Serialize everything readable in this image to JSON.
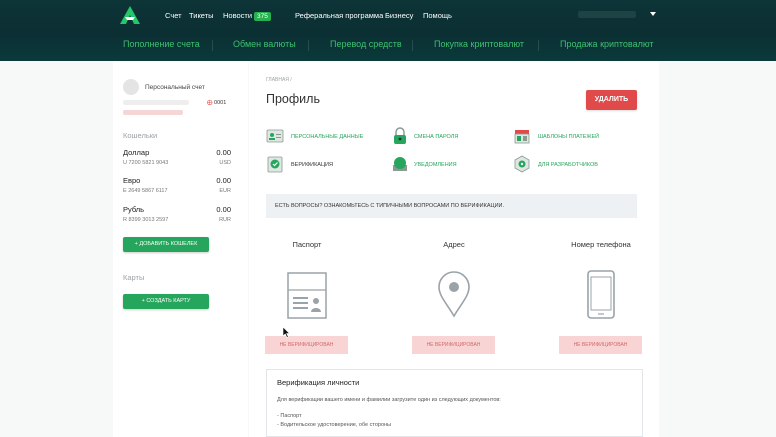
{
  "header": {
    "nav": {
      "account": "Счет",
      "tickets": "Тикеты",
      "news": "Новости",
      "news_count": "375",
      "referral": "Реферальная программа",
      "business": "Бизнесу",
      "help": "Помощь"
    },
    "subnav": [
      "Пополнение счета",
      "Обмен валюты",
      "Перевод средств",
      "Покупка криптовалют",
      "Продажа криптовалют"
    ],
    "colors": {
      "accent": "#26a55c",
      "header_bg": "#0b2f33",
      "danger": "#e04a4a"
    }
  },
  "sidebar": {
    "account_label": "Персональный счет",
    "account_id_prefix": "⨁",
    "account_id": "0001",
    "wallets_title": "Кошельки",
    "wallets": [
      {
        "name": "Доллар",
        "amount": "0.00",
        "number": "U 7200 5821 9043",
        "currency": "USD"
      },
      {
        "name": "Евро",
        "amount": "0.00",
        "number": "E 2649 5867 6117",
        "currency": "EUR"
      },
      {
        "name": "Рубль",
        "amount": "0.00",
        "number": "R 8399 3013 2597",
        "currency": "RUR"
      }
    ],
    "add_wallet": "+ ДОБАВИТЬ КОШЕЛЕК",
    "cards_title": "Карты",
    "create_card": "+ СОЗДАТЬ КАРТУ"
  },
  "main": {
    "breadcrumb": "ГЛАВНАЯ /",
    "title": "Профиль",
    "delete_button": "УДАЛИТЬ",
    "links": [
      "ПЕРСОНАЛЬНЫЕ ДАННЫЕ",
      "СМЕНА ПАРОЛЯ",
      "ШАБЛОНЫ ПЛАТЕЖЕЙ",
      "ВЕРИФИКАЦИЯ",
      "УВЕДОМЛЕНИЯ",
      "ДЛЯ РАЗРАБОТЧИКОВ"
    ],
    "info": "ЕСТЬ ВОПРОСЫ? ОЗНАКОМЬТЕСЬ С ТИПИЧНЫМИ ВОПРОСАМИ ПО ВЕРИФИКАЦИИ.",
    "verification": [
      {
        "title": "Паспорт",
        "status": "НЕ ВЕРИФИЦИРОВАН",
        "icon": "passport-icon"
      },
      {
        "title": "Адрес",
        "status": "НЕ ВЕРИФИЦИРОВАН",
        "icon": "location-pin-icon"
      },
      {
        "title": "Номер телефона",
        "status": "НЕ ВЕРИФИЦИРОВАН",
        "icon": "phone-icon"
      }
    ],
    "card": {
      "title": "Верификация личности",
      "text": "Для верификации вашего имени и фамилии загрузите один из следующих документов:",
      "items": [
        "- Паспорт",
        "- Водительское удостоверение, обе стороны"
      ]
    }
  }
}
